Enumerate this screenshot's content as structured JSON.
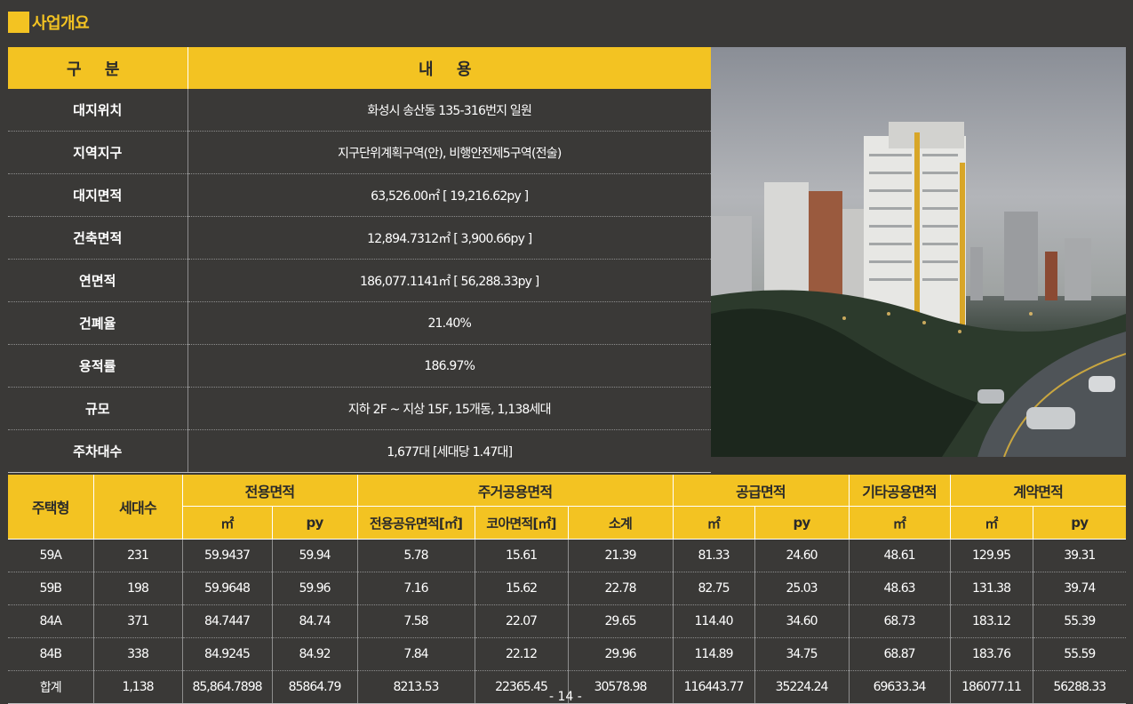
{
  "section_title": "사업개요",
  "overview": {
    "headers": [
      "구 분",
      "내 용"
    ],
    "rows": [
      {
        "label": "대지위치",
        "value": "화성시 송산동 135-316번지 일원"
      },
      {
        "label": "지역지구",
        "value": "지구단위계획구역(안), 비행안전제5구역(전술)"
      },
      {
        "label": "대지면적",
        "value": "63,526.00㎡ [ 19,216.62py ]"
      },
      {
        "label": "건축면적",
        "value": "12,894.7312㎡ [ 3,900.66py ]"
      },
      {
        "label": "연면적",
        "value": "186,077.1141㎡ [ 56,288.33py ]"
      },
      {
        "label": "건폐율",
        "value": "21.40%"
      },
      {
        "label": "용적률",
        "value": "186.97%"
      },
      {
        "label": "규모",
        "value": "지하 2F ~ 지상 15F, 15개동, 1,138세대"
      },
      {
        "label": "주차대수",
        "value": "1,677대 [세대당 1.47대]"
      }
    ]
  },
  "area_table": {
    "header_row1": {
      "type": "주택형",
      "units": "세대수",
      "exclusive": "전용면적",
      "residential_common": "주거공용면적",
      "supply": "공급면적",
      "other_common": "기타공용면적",
      "contract": "계약면적"
    },
    "header_row2": [
      "㎡",
      "py",
      "전용공유면적[㎡]",
      "코아면적[㎡]",
      "소계",
      "㎡",
      "py",
      "㎡",
      "㎡",
      "py"
    ],
    "rows": [
      [
        "59A",
        "231",
        "59.9437",
        "59.94",
        "5.78",
        "15.61",
        "21.39",
        "81.33",
        "24.60",
        "48.61",
        "129.95",
        "39.31"
      ],
      [
        "59B",
        "198",
        "59.9648",
        "59.96",
        "7.16",
        "15.62",
        "22.78",
        "82.75",
        "25.03",
        "48.63",
        "131.38",
        "39.74"
      ],
      [
        "84A",
        "371",
        "84.7447",
        "84.74",
        "7.58",
        "22.07",
        "29.65",
        "114.40",
        "34.60",
        "68.73",
        "183.12",
        "55.39"
      ],
      [
        "84B",
        "338",
        "84.9245",
        "84.92",
        "7.84",
        "22.12",
        "29.96",
        "114.89",
        "34.75",
        "68.87",
        "183.76",
        "55.59"
      ],
      [
        "합계",
        "1,138",
        "85,864.7898",
        "85864.79",
        "8213.53",
        "22365.45",
        "30578.98",
        "116443.77",
        "35224.24",
        "69633.34",
        "186077.11",
        "56288.33"
      ]
    ]
  },
  "page_number": "- 14 -",
  "colors": {
    "accent": "#f3c322",
    "background": "#3a3937"
  }
}
